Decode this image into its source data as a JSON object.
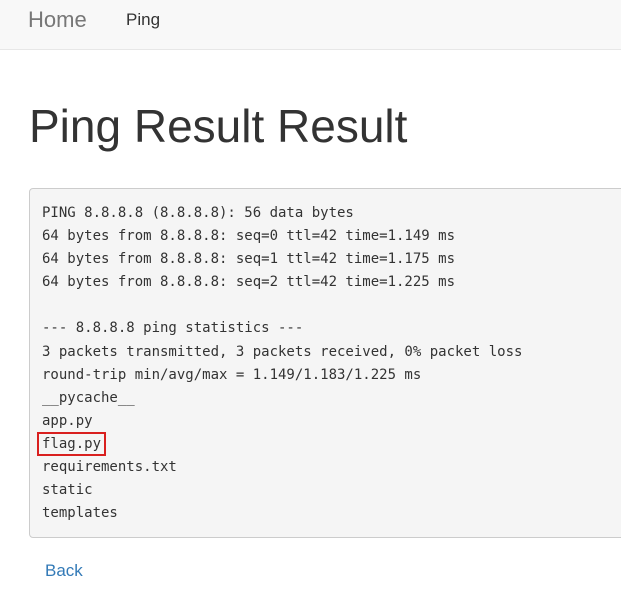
{
  "navbar": {
    "brand": "Home",
    "links": [
      {
        "label": "Ping"
      }
    ]
  },
  "page": {
    "title": "Ping Result Result"
  },
  "output": {
    "lines": [
      "PING 8.8.8.8 (8.8.8.8): 56 data bytes",
      "64 bytes from 8.8.8.8: seq=0 ttl=42 time=1.149 ms",
      "64 bytes from 8.8.8.8: seq=1 ttl=42 time=1.175 ms",
      "64 bytes from 8.8.8.8: seq=2 ttl=42 time=1.225 ms",
      "",
      "--- 8.8.8.8 ping statistics ---",
      "3 packets transmitted, 3 packets received, 0% packet loss",
      "round-trip min/avg/max = 1.149/1.183/1.225 ms",
      "__pycache__",
      "app.py",
      "flag.py",
      "requirements.txt",
      "static",
      "templates"
    ],
    "highlight_color": "#d9201f"
  },
  "footer": {
    "back_label": "Back"
  },
  "colors": {
    "navbar_bg": "#f8f8f8",
    "link": "#337ab7",
    "brand": "#777777"
  }
}
